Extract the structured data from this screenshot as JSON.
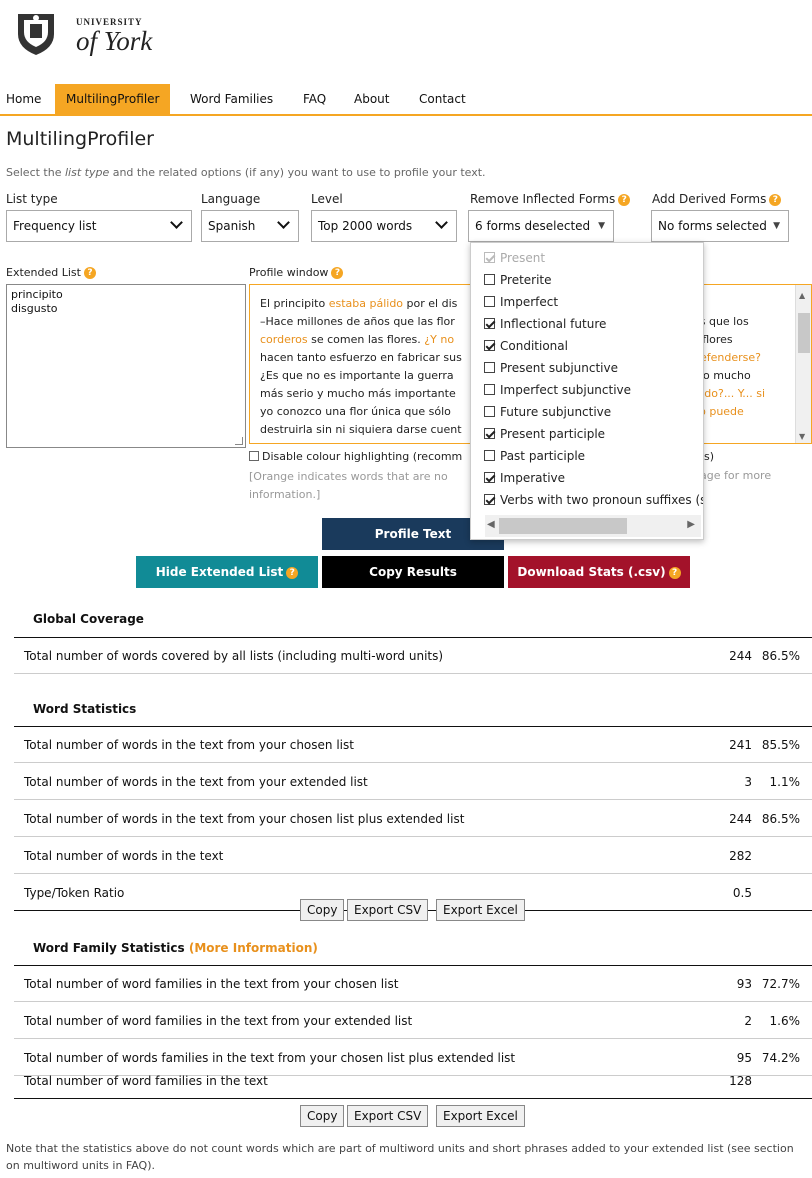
{
  "logo": {
    "university": "UNIVERSITY",
    "york": "of York"
  },
  "nav": {
    "items": [
      {
        "label": "Home"
      },
      {
        "label": "MultilingProfiler",
        "active": true
      },
      {
        "label": "Word Families"
      },
      {
        "label": "FAQ"
      },
      {
        "label": "About"
      },
      {
        "label": "Contact"
      }
    ]
  },
  "page": {
    "title": "MultilingProfiler",
    "intro_a": "Select the ",
    "intro_em": "list type",
    "intro_b": " and the related options (if any) you want to use to profile your text."
  },
  "controls": {
    "list_type": {
      "label": "List type",
      "value": "Frequency list"
    },
    "language": {
      "label": "Language",
      "value": "Spanish"
    },
    "level": {
      "label": "Level",
      "value": "Top 2000 words"
    },
    "remove_inflected": {
      "label": "Remove Inflected Forms",
      "value": "6 forms deselected"
    },
    "add_derived": {
      "label": "Add Derived Forms",
      "value": "No forms selected"
    }
  },
  "extended_list": {
    "label": "Extended List",
    "lines": [
      "principito",
      "disgusto"
    ]
  },
  "profile_window": {
    "label": "Profile window",
    "lines": [
      [
        "El principito ",
        "estaba pálido",
        " por el dis"
      ],
      [
        "–Hace millones de años que las flor",
        "",
        ""
      ],
      [
        "",
        "corderos",
        " se comen las flores. "
      ],
      [
        "hacen tanto esfuerzo en fabricar sus",
        "",
        ""
      ],
      [
        "¿Es que no es importante la guerra ",
        "",
        ""
      ],
      [
        "más serio y mucho más importante",
        "",
        ""
      ],
      [
        "yo conozco una flor única que sólo",
        "",
        ""
      ],
      [
        "destruirla sin ni siquiera darse cuent",
        "",
        ""
      ]
    ],
    "line3_tail": "¿Y no",
    "right_fragments": [
      "os que los",
      "s flores",
      "defenderse?",
      "sto mucho",
      "rado?... Y... si",
      "llo puede"
    ]
  },
  "highlight": {
    "checkbox_label": "Disable colour highlighting (recomm",
    "checkbox_tail": "ds)",
    "note_line1": "[Orange indicates words that are no",
    "note_tail": "age for more",
    "note_line2": "information.]"
  },
  "buttons": {
    "profile": "Profile Text",
    "hide_ext": "Hide Extended List",
    "copy_results": "Copy Results",
    "download": "Download Stats (.csv)"
  },
  "inflected_dropdown": {
    "options": [
      {
        "label": "Present",
        "checked": true,
        "disabled": true
      },
      {
        "label": "Preterite",
        "checked": false
      },
      {
        "label": "Imperfect",
        "checked": false
      },
      {
        "label": "Inflectional future",
        "checked": true
      },
      {
        "label": "Conditional",
        "checked": true
      },
      {
        "label": "Present subjunctive",
        "checked": false
      },
      {
        "label": "Imperfect subjunctive",
        "checked": false
      },
      {
        "label": "Future subjunctive",
        "checked": false
      },
      {
        "label": "Present participle",
        "checked": true
      },
      {
        "label": "Past participle",
        "checked": false
      },
      {
        "label": "Imperative",
        "checked": true
      },
      {
        "label": "Verbs with two pronoun suffixes (s",
        "checked": true
      }
    ]
  },
  "global_coverage": {
    "title": "Global Coverage",
    "rows": [
      {
        "label": "Total number of words covered by all lists (including multi-word units)",
        "n": "244",
        "p": "86.5%"
      }
    ]
  },
  "word_stats": {
    "title": "Word Statistics",
    "rows": [
      {
        "label": "Total number of words in the text from your chosen list",
        "n": "241",
        "p": "85.5%"
      },
      {
        "label": "Total number of words in the text from your extended list",
        "n": "3",
        "p": "1.1%"
      },
      {
        "label": "Total number of words in the text from your chosen list plus extended list",
        "n": "244",
        "p": "86.5%"
      },
      {
        "label": "Total number of words in the text",
        "n": "282",
        "p": ""
      },
      {
        "label": "Type/Token Ratio",
        "n": "0.5",
        "p": ""
      }
    ]
  },
  "family_stats": {
    "title": "Word Family Statistics",
    "more": "(More Information)",
    "rows": [
      {
        "label": "Total number of word families in the text from your chosen list",
        "n": "93",
        "p": "72.7%"
      },
      {
        "label": "Total number of word families in the text from your extended list",
        "n": "2",
        "p": "1.6%"
      },
      {
        "label": "Total number of words families in the text from your chosen list plus extended list",
        "n": "95",
        "p": "74.2%"
      },
      {
        "label": "Total number of word families in the text",
        "n": "128",
        "p": ""
      }
    ]
  },
  "export": {
    "copy": "Copy",
    "csv": "Export CSV",
    "excel": "Export Excel"
  },
  "footer": {
    "note": "Note that the statistics above do not count words which are part of multiword units and short phrases added to your extended list (see section on multiword units in FAQ)."
  },
  "colors": {
    "accent": "#f5a623",
    "navy": "#1a3a5c",
    "teal": "#118b96",
    "crimson": "#a3122a"
  }
}
